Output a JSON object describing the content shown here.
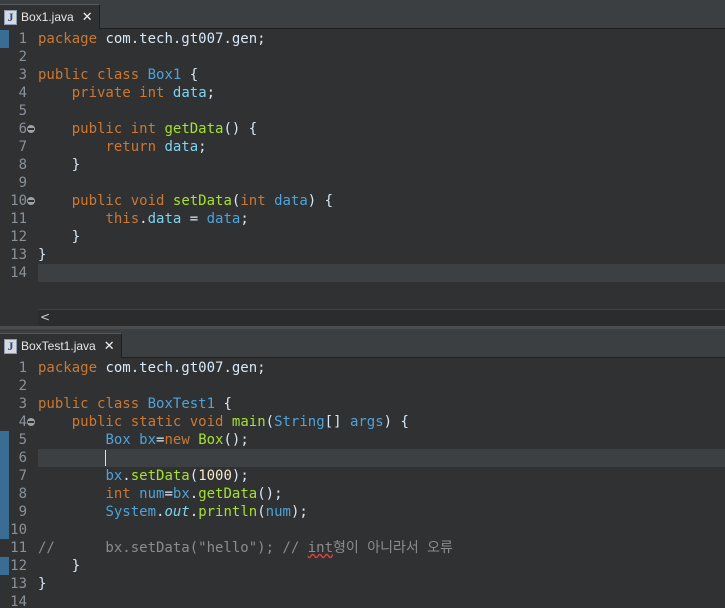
{
  "top": {
    "tab_label": "Box1.java",
    "line_numbers": [
      "1",
      "2",
      "3",
      "4",
      "5",
      "6",
      "7",
      "8",
      "9",
      "10",
      "11",
      "12",
      "13",
      "14"
    ],
    "lines": [
      {
        "t": [
          [
            "kw",
            "package"
          ],
          [
            "plain",
            " com.tech.gt007.gen;"
          ]
        ]
      },
      {
        "t": []
      },
      {
        "t": [
          [
            "kw",
            "public"
          ],
          [
            "plain",
            " "
          ],
          [
            "kw",
            "class"
          ],
          [
            "plain",
            " "
          ],
          [
            "cls",
            "Box1"
          ],
          [
            "plain",
            " {"
          ]
        ]
      },
      {
        "t": [
          [
            "plain",
            "    "
          ],
          [
            "kw",
            "private"
          ],
          [
            "plain",
            " "
          ],
          [
            "kw",
            "int"
          ],
          [
            "plain",
            " "
          ],
          [
            "fld",
            "data"
          ],
          [
            "plain",
            ";"
          ]
        ]
      },
      {
        "t": []
      },
      {
        "t": [
          [
            "plain",
            "    "
          ],
          [
            "kw",
            "public"
          ],
          [
            "plain",
            " "
          ],
          [
            "kw",
            "int"
          ],
          [
            "plain",
            " "
          ],
          [
            "mth",
            "getData"
          ],
          [
            "plain",
            "() {"
          ]
        ]
      },
      {
        "t": [
          [
            "plain",
            "        "
          ],
          [
            "kw",
            "return"
          ],
          [
            "plain",
            " "
          ],
          [
            "fld",
            "data"
          ],
          [
            "plain",
            ";"
          ]
        ]
      },
      {
        "t": [
          [
            "plain",
            "    }"
          ]
        ]
      },
      {
        "t": []
      },
      {
        "t": [
          [
            "plain",
            "    "
          ],
          [
            "kw",
            "public"
          ],
          [
            "plain",
            " "
          ],
          [
            "kw",
            "void"
          ],
          [
            "plain",
            " "
          ],
          [
            "mth",
            "setData"
          ],
          [
            "plain",
            "("
          ],
          [
            "kw",
            "int"
          ],
          [
            "plain",
            " "
          ],
          [
            "cls",
            "data"
          ],
          [
            "plain",
            ") {"
          ]
        ]
      },
      {
        "t": [
          [
            "plain",
            "        "
          ],
          [
            "kw",
            "this"
          ],
          [
            "plain",
            "."
          ],
          [
            "fld",
            "data"
          ],
          [
            "plain",
            " = "
          ],
          [
            "cls",
            "data"
          ],
          [
            "plain",
            ";"
          ]
        ]
      },
      {
        "t": [
          [
            "plain",
            "    }"
          ]
        ]
      },
      {
        "t": [
          [
            "plain",
            "}"
          ]
        ]
      },
      {
        "t": []
      }
    ],
    "scroll_arrow": "<"
  },
  "bottom": {
    "tab_label": "BoxTest1.java",
    "line_numbers": [
      "1",
      "2",
      "3",
      "4",
      "5",
      "6",
      "7",
      "8",
      "9",
      "10",
      "11",
      "12",
      "13",
      "14"
    ],
    "lines": [
      {
        "t": [
          [
            "kw",
            "package"
          ],
          [
            "plain",
            " com.tech.gt007.gen;"
          ]
        ]
      },
      {
        "t": []
      },
      {
        "t": [
          [
            "kw",
            "public"
          ],
          [
            "plain",
            " "
          ],
          [
            "kw",
            "class"
          ],
          [
            "plain",
            " "
          ],
          [
            "cls",
            "BoxTest1"
          ],
          [
            "plain",
            " {"
          ]
        ]
      },
      {
        "t": [
          [
            "plain",
            "    "
          ],
          [
            "kw",
            "public"
          ],
          [
            "plain",
            " "
          ],
          [
            "kw",
            "static"
          ],
          [
            "plain",
            " "
          ],
          [
            "kw",
            "void"
          ],
          [
            "plain",
            " "
          ],
          [
            "mth",
            "main"
          ],
          [
            "plain",
            "("
          ],
          [
            "cls",
            "String"
          ],
          [
            "plain",
            "[] "
          ],
          [
            "cls",
            "args"
          ],
          [
            "plain",
            ") {"
          ]
        ]
      },
      {
        "t": [
          [
            "plain",
            "        "
          ],
          [
            "cls",
            "Box"
          ],
          [
            "plain",
            " "
          ],
          [
            "cls",
            "bx"
          ],
          [
            "plain",
            "="
          ],
          [
            "kw",
            "new"
          ],
          [
            "plain",
            " "
          ],
          [
            "mth",
            "Box"
          ],
          [
            "plain",
            "();"
          ]
        ]
      },
      {
        "t": [
          [
            "plain",
            "        "
          ],
          [
            "caret",
            ""
          ]
        ]
      },
      {
        "t": [
          [
            "plain",
            "        "
          ],
          [
            "cls",
            "bx"
          ],
          [
            "plain",
            "."
          ],
          [
            "mth",
            "setData"
          ],
          [
            "plain",
            "("
          ],
          [
            "num",
            "1000"
          ],
          [
            "plain",
            ");"
          ]
        ]
      },
      {
        "t": [
          [
            "plain",
            "        "
          ],
          [
            "kw",
            "int"
          ],
          [
            "plain",
            " "
          ],
          [
            "cls",
            "num"
          ],
          [
            "plain",
            "="
          ],
          [
            "cls",
            "bx"
          ],
          [
            "plain",
            "."
          ],
          [
            "mth",
            "getData"
          ],
          [
            "plain",
            "();"
          ]
        ]
      },
      {
        "t": [
          [
            "plain",
            "        "
          ],
          [
            "cls",
            "System"
          ],
          [
            "plain",
            "."
          ],
          [
            "fld ital",
            "out"
          ],
          [
            "plain",
            "."
          ],
          [
            "mth",
            "println"
          ],
          [
            "plain",
            "("
          ],
          [
            "cls",
            "num"
          ],
          [
            "plain",
            ");"
          ]
        ]
      },
      {
        "t": []
      },
      {
        "t": [
          [
            "cmt",
            "//      bx.setData(\"hello\"); // "
          ],
          [
            "cmt squig",
            "int"
          ],
          [
            "cmt",
            "형이 아니라서 오류"
          ]
        ]
      },
      {
        "t": [
          [
            "plain",
            "    }"
          ]
        ]
      },
      {
        "t": [
          [
            "plain",
            "}"
          ]
        ]
      },
      {
        "t": []
      }
    ]
  }
}
